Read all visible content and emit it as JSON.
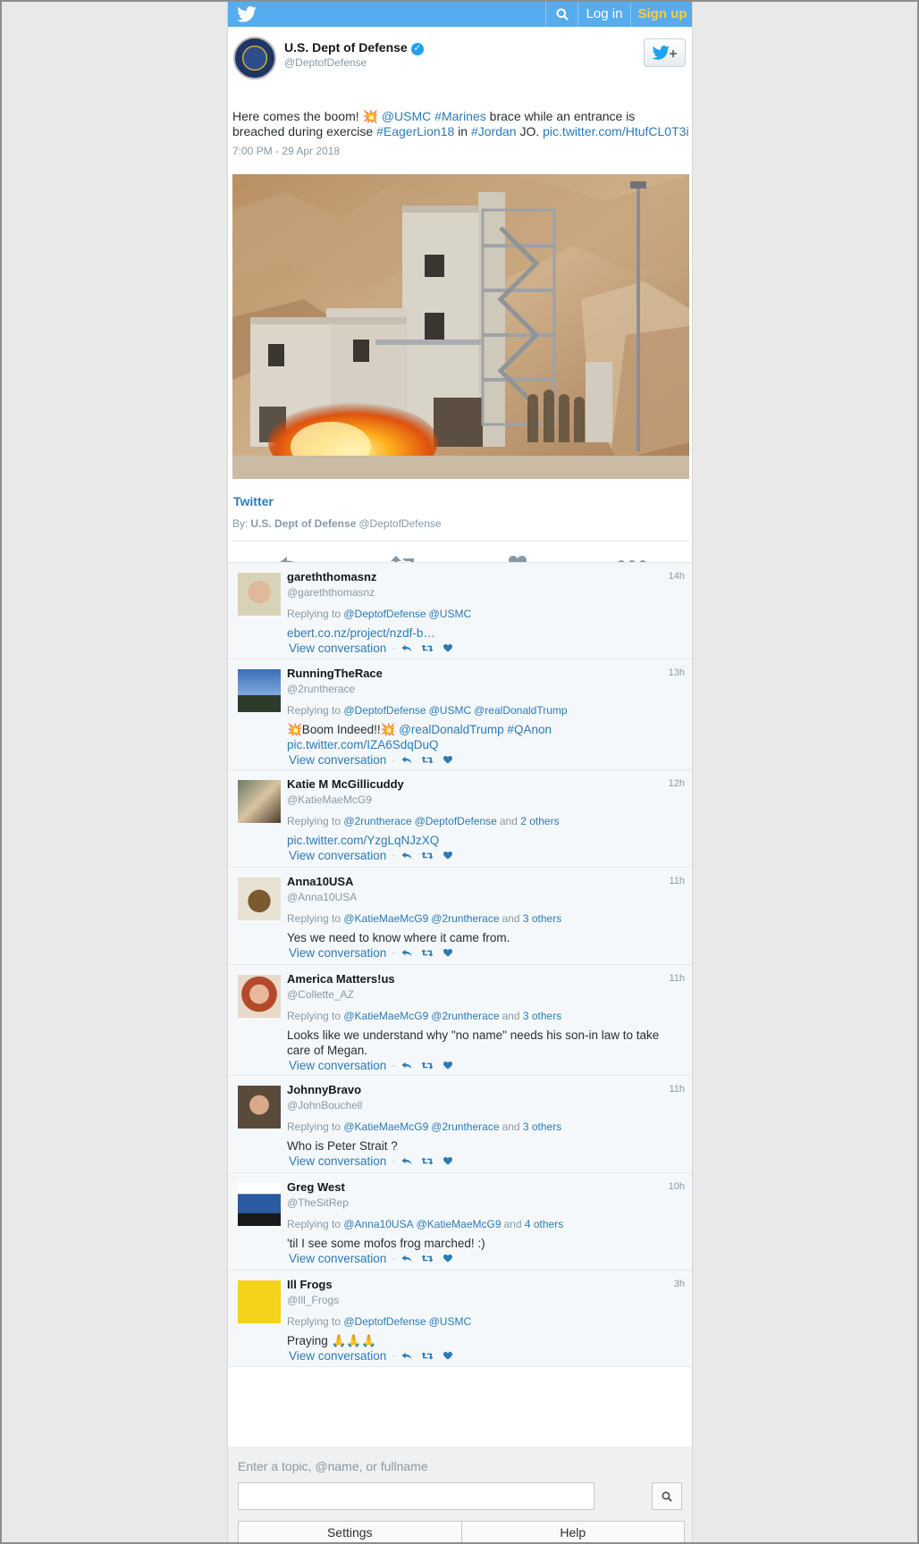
{
  "topbar": {
    "login": "Log in",
    "signup": "Sign up"
  },
  "tweet": {
    "name": "U.S. Dept of Defense",
    "handle": "@DeptofDefense",
    "text_parts": [
      {
        "t": "Here comes the boom! 💥 ",
        "link": false
      },
      {
        "t": "@USMC",
        "link": true
      },
      {
        "t": " ",
        "link": false
      },
      {
        "t": "#Marines",
        "link": true
      },
      {
        "t": " brace while an entrance is breached during exercise ",
        "link": false
      },
      {
        "t": "#EagerLion18",
        "link": true
      },
      {
        "t": " in ",
        "link": false
      },
      {
        "t": "#Jordan",
        "link": true
      },
      {
        "t": " JO. ",
        "link": false
      },
      {
        "t": "pic.twitter.com/HtufCL0T3i",
        "link": true
      }
    ],
    "time": "7:00 PM - 29 Apr 2018",
    "card_title": "Twitter",
    "by_label": "By:",
    "by_name": "U.S. Dept of Defense",
    "by_handle": "@DeptofDefense"
  },
  "replies": [
    {
      "name": "garethth omasnz",
      "display": "garethth omasnz",
      "handle": "@garethth omasnz",
      "time": "14h",
      "replying": [
        "@DeptofDefense",
        "@USMC"
      ],
      "others": "",
      "text": "",
      "link_text": "ebert.co.nz/project/nzdf-b…",
      "view": "View conversation"
    },
    {
      "name": "RunningTheRace",
      "handle": "@2runtherace",
      "time": "13h",
      "replying": [
        "@DeptofDefense",
        "@USMC",
        "@realDonaldTrump"
      ],
      "others": "",
      "text": "💥Boom Indeed!!💥",
      "link_text": "@realDonaldTrump #QAnon pic.twitter.com/IZA6SdqDuQ",
      "view": "View conversation"
    },
    {
      "name": "Katie M McGillicuddy",
      "handle": "@KatieMaeMcG9",
      "time": "12h",
      "replying": [
        "@2runtherace",
        "@DeptofDefense"
      ],
      "others": "2 others",
      "text": "",
      "link_text": "pic.twitter.com/YzgLqNJzXQ",
      "view": "View conversation"
    },
    {
      "name": "Anna10USA",
      "handle": "@Anna10USA",
      "time": "11h",
      "replying": [
        "@KatieMaeMcG9",
        "@2runtherace"
      ],
      "others": "3 others",
      "text": "Yes we need to know where it came from.",
      "link_text": "",
      "view": "View conversation"
    },
    {
      "name": "America Matters!us",
      "handle": "@Collette_AZ",
      "time": "11h",
      "replying": [
        "@KatieMaeMcG9",
        "@2runtherace"
      ],
      "others": "3 others",
      "text": "Looks like we understand why \"no name\" needs his son-in law to take care of Megan.",
      "link_text": "",
      "view": "View conversation"
    },
    {
      "name": "JohnnyBravo",
      "handle": "@JohnBouchell",
      "time": "11h",
      "replying": [
        "@KatieMaeMcG9",
        "@2runtherace"
      ],
      "others": "3 others",
      "text": "Who is Peter Strait ?",
      "link_text": "",
      "view": "View conversation"
    },
    {
      "name": "Greg West",
      "handle": "@TheSitRep",
      "time": "10h",
      "replying": [
        "@Anna10USA",
        "@KatieMaeMcG9"
      ],
      "others": "4 others",
      "text": "'til I see some mofos frog marched! :)",
      "link_text": "",
      "view": "View conversation"
    },
    {
      "name": "Ill Frogs",
      "handle": "@Ill_Frogs",
      "time": "3h",
      "replying": [
        "@DeptofDefense",
        "@USMC"
      ],
      "others": "",
      "text": "Praying 🙏🙏🙏",
      "link_text": "",
      "view": "View conversation"
    }
  ],
  "search": {
    "label": "Enter a topic, @name, or fullname",
    "settings": "Settings",
    "help": "Help"
  },
  "colors": {
    "brand": "#55acee",
    "link": "#2b7bb9",
    "signup": "#ffcc33"
  }
}
